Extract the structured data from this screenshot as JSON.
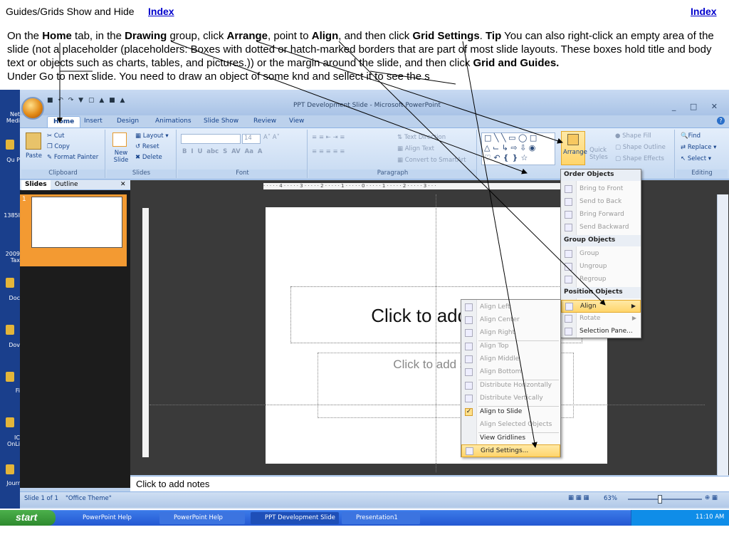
{
  "header": {
    "title": "Guides/Grids Show and Hide",
    "index_link_left": "Index",
    "index_link_right": "Index"
  },
  "instructions": {
    "p1": "On the ",
    "home": "Home",
    "p2": " tab, in the ",
    "drawing": "Drawing",
    "p3": " group, click ",
    "arrange": "Arrange",
    "p4": ", point to ",
    "align": "Align",
    "p5": ", and then click ",
    "grid_settings": "Grid Settings",
    "p6": ".  ",
    "tip": "Tip",
    "p7": "   You can also right-click an empty area of the slide (not a placeholder (placeholders: Boxes with dotted or hatch-marked borders that are part of most slide layouts. These boxes hold title and body text or objects such as charts, tables, and pictures.)) or the margin around the slide, and then click ",
    "grid_guides": "Grid and Guides.",
    "line2": "Under  Go to next slide. You need to draw an object of some knd and sellect it to see the s"
  },
  "desktop": {
    "labels": [
      "Net Medi",
      "Qu P",
      "1385I",
      "2009 Tax",
      "Doc",
      "Dov",
      "Fi",
      "IC OnLi",
      "Jourr"
    ]
  },
  "window": {
    "title": "PPT Development Slide - Microsoft PowerPoint",
    "tabs": [
      "Home",
      "Insert",
      "Design",
      "Animations",
      "Slide Show",
      "Review",
      "View"
    ]
  },
  "ribbon": {
    "clipboard": {
      "label": "Clipboard",
      "paste": "Paste",
      "cut": "Cut",
      "copy": "Copy",
      "format_painter": "Format Painter"
    },
    "slides": {
      "label": "Slides",
      "new_slide": "New Slide",
      "layout": "Layout",
      "reset": "Reset",
      "delete": "Delete"
    },
    "font": {
      "label": "Font",
      "size": "14"
    },
    "paragraph": {
      "label": "Paragraph",
      "text_direction": "Text Direction",
      "align_text": "Align Text",
      "smartart": "Convert to SmartArt"
    },
    "drawing": {
      "arrange": "Arrange",
      "quick_styles": "Quick Styles",
      "shape_fill": "Shape Fill",
      "shape_outline": "Shape Outline",
      "shape_effects": "Shape Effects"
    },
    "editing": {
      "label": "Editing",
      "find": "Find",
      "replace": "Replace",
      "select": "Select"
    }
  },
  "pane": {
    "tab_slides": "Slides",
    "tab_outline": "Outline",
    "slide_number": "1"
  },
  "ruler": "· · · · · 4 · · · · · 3 · · · · · 2 · · · · · 1 · · · · · 0 · · · · · 1 · · · · · 2 · · · · · 3 · · ·",
  "slide": {
    "title_placeholder": "Click to add title",
    "subtitle_placeholder": "Click to add subtitle"
  },
  "notes": "Click to add notes",
  "status": {
    "slide_count": "Slide 1 of 1",
    "theme": "\"Office Theme\"",
    "zoom": "63%"
  },
  "arrange_menu": {
    "order_header": "Order Objects",
    "order_items": [
      "Bring to Front",
      "Send to Back",
      "Bring Forward",
      "Send Backward"
    ],
    "group_header": "Group Objects",
    "group_items": [
      "Group",
      "Ungroup",
      "Regroup"
    ],
    "position_header": "Position Objects",
    "align": "Align",
    "rotate": "Rotate",
    "selection_pane": "Selection Pane..."
  },
  "align_menu": {
    "items": [
      "Align Left",
      "Align Center",
      "Align Right",
      "Align Top",
      "Align Middle",
      "Align Bottom",
      "Distribute Horizontally",
      "Distribute Vertically",
      "Align to Slide",
      "Align Selected Objects",
      "View Gridlines",
      "Grid Settings..."
    ]
  },
  "taskbar": {
    "start": "start",
    "buttons": [
      "PowerPoint Help",
      "PowerPoint Help",
      "PPT Development Slide",
      "Presentation1"
    ],
    "clock": "11:10 AM"
  },
  "colors": {
    "accent_orange": "#f39a32",
    "office_blue": "#15428b",
    "taskbar_blue": "#2458d2"
  }
}
